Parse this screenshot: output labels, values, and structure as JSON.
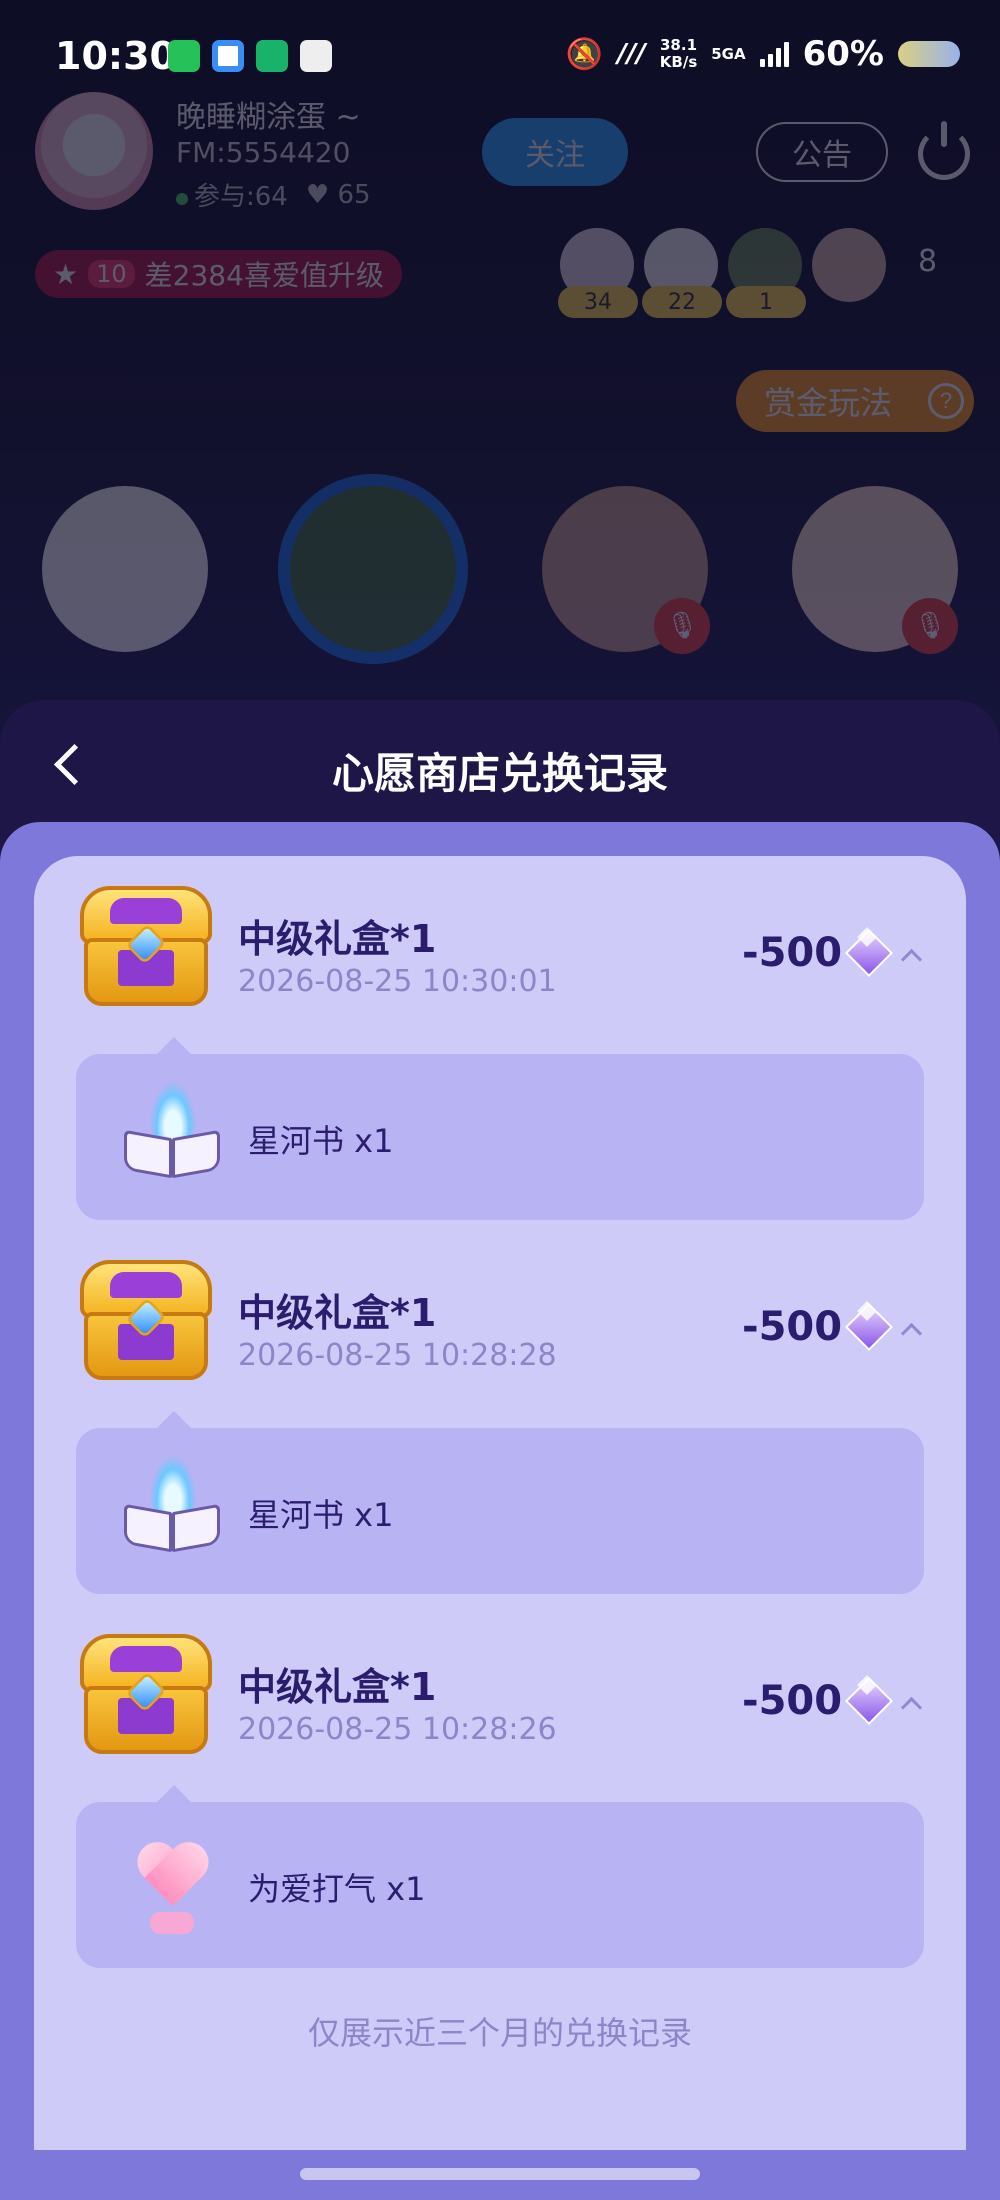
{
  "status_bar": {
    "time": "10:30",
    "net_speed": "38.1",
    "net_unit": "KB/s",
    "network": "5GA",
    "battery": "60%"
  },
  "room": {
    "host_name": "晚睡糊涂蛋 ~",
    "fm_id": "FM:5554420",
    "participants": "参与:64",
    "likes": "65",
    "follow_label": "关注",
    "notice_label": "公告",
    "level": "10",
    "level_text": "差2384喜爱值升级",
    "audience_badges": [
      "34",
      "22",
      "1"
    ],
    "audience_count": "8",
    "bounty_label": "赏金玩法",
    "help_glyph": "?"
  },
  "sheet": {
    "title": "心愿商店兑换记录",
    "records": [
      {
        "name": "中级礼盒*1",
        "time": "2026-08-25 10:30:01",
        "cost": "-500",
        "reward": "星河书 x1",
        "reward_icon": "book-icon"
      },
      {
        "name": "中级礼盒*1",
        "time": "2026-08-25 10:28:28",
        "cost": "-500",
        "reward": "星河书 x1",
        "reward_icon": "book-icon"
      },
      {
        "name": "中级礼盒*1",
        "time": "2026-08-25 10:28:26",
        "cost": "-500",
        "reward": "为爱打气 x1",
        "reward_icon": "heart-icon"
      }
    ],
    "footer_note": "仅展示近三个月的兑换记录"
  },
  "colors": {
    "sheet_header": "#1f1648",
    "sheet_body": "#7d78d9",
    "card": "#cfcbf9",
    "reward_panel": "#b8b3f3",
    "title_text": "#2a1d6e",
    "muted_text": "#8c86c9"
  }
}
